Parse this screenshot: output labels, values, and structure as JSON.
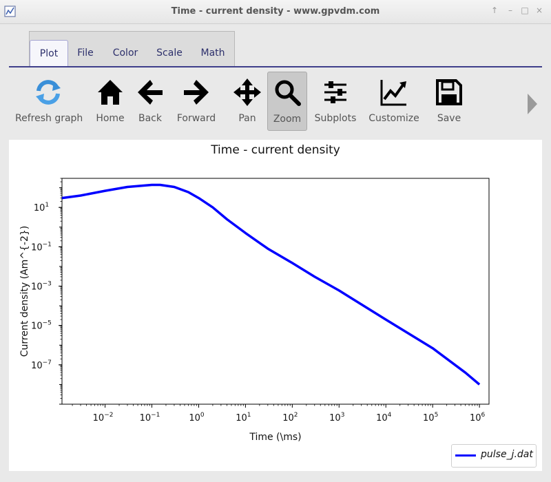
{
  "window": {
    "title": "Time - current density - www.gpvdm.com",
    "controls": [
      "up-arrow-icon",
      "minimize-icon",
      "maximize-icon",
      "close-icon"
    ]
  },
  "tabs": [
    {
      "label": "Plot",
      "active": true
    },
    {
      "label": "File",
      "active": false
    },
    {
      "label": "Color",
      "active": false
    },
    {
      "label": "Scale",
      "active": false
    },
    {
      "label": "Math",
      "active": false
    }
  ],
  "toolbar": {
    "refresh": "Refresh graph",
    "home": "Home",
    "back": "Back",
    "forward": "Forward",
    "pan": "Pan",
    "zoom": "Zoom",
    "subplots": "Subplots",
    "customize": "Customize",
    "save": "Save",
    "pressed": "Zoom"
  },
  "chart_data": {
    "type": "line",
    "title": "Time - current density",
    "xlabel": "Time (\\ms)",
    "ylabel": "Current density (Am^{-2})",
    "xscale": "log",
    "yscale": "log",
    "xlim": [
      0.0012,
      1600000.0
    ],
    "ylim": [
      1e-09,
      300
    ],
    "x_ticks": [
      {
        "exp": -2,
        "base": "10",
        "sup": "−2"
      },
      {
        "exp": -1,
        "base": "10",
        "sup": "−1"
      },
      {
        "exp": 0,
        "base": "10",
        "sup": "0"
      },
      {
        "exp": 1,
        "base": "10",
        "sup": "1"
      },
      {
        "exp": 2,
        "base": "10",
        "sup": "2"
      },
      {
        "exp": 3,
        "base": "10",
        "sup": "3"
      },
      {
        "exp": 4,
        "base": "10",
        "sup": "4"
      },
      {
        "exp": 5,
        "base": "10",
        "sup": "5"
      },
      {
        "exp": 6,
        "base": "10",
        "sup": "6"
      }
    ],
    "y_ticks": [
      {
        "exp": 1,
        "base": "10",
        "sup": "1"
      },
      {
        "exp": -1,
        "base": "10",
        "sup": "−1"
      },
      {
        "exp": -3,
        "base": "10",
        "sup": "−3"
      },
      {
        "exp": -5,
        "base": "10",
        "sup": "−5"
      },
      {
        "exp": -7,
        "base": "10",
        "sup": "−7"
      }
    ],
    "grid": false,
    "legend_position": "bottom-right",
    "series": [
      {
        "name": "pulse_j.dat",
        "color": "#0000ff",
        "x": [
          0.0012,
          0.003,
          0.01,
          0.03,
          0.1,
          0.15,
          0.3,
          0.6,
          1,
          2,
          4,
          10,
          30,
          100,
          300,
          1000,
          10000.0,
          100000.0,
          500000.0,
          1000000.0
        ],
        "y": [
          30,
          40,
          70,
          110,
          140,
          140,
          110,
          60,
          30,
          10,
          2.5,
          0.5,
          0.08,
          0.015,
          0.003,
          0.0006,
          2e-05,
          7e-07,
          4e-08,
          1e-08
        ]
      }
    ]
  }
}
